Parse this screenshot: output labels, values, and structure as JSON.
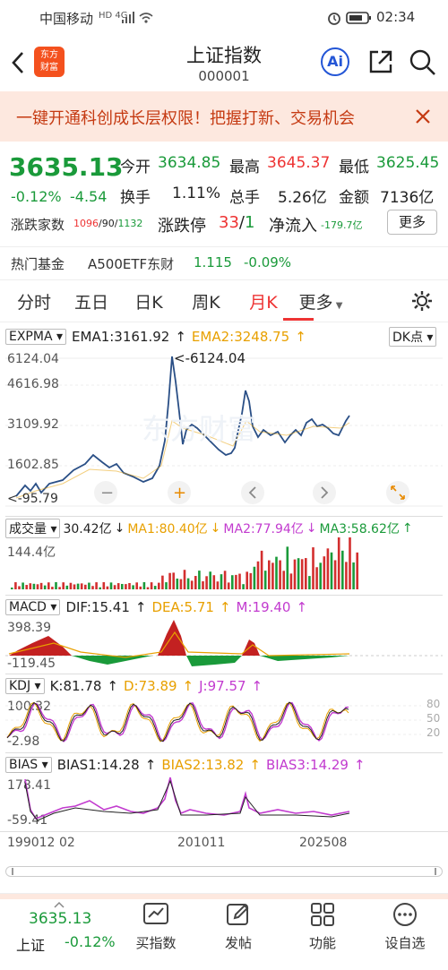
{
  "status_bar": {
    "carrier": "中国移动",
    "net": "HD 4G",
    "time": "02:34"
  },
  "header": {
    "title": "上证指数",
    "code": "000001",
    "logo_line1": "东方",
    "logo_line2": "财富",
    "ai_label": "Ai"
  },
  "banner": {
    "text": "一键开通科创成长层权限！把握打新、交易机会"
  },
  "quote": {
    "price": "3635.13",
    "change_pct": "-0.12%",
    "change": "-4.54",
    "open_label": "今开",
    "open": "3634.85",
    "high_label": "最高",
    "high": "3645.37",
    "low_label": "最低",
    "low": "3625.45",
    "turnover_label": "换手",
    "turnover": "1.11%",
    "volume_label": "总手",
    "volume": "5.26亿",
    "amount_label": "金额",
    "amount": "7136亿",
    "breadth_label": "涨跌家数",
    "up": "1096",
    "flat": "90",
    "down": "1132",
    "limit_label": "涨跌停",
    "limit_up": "33",
    "limit_down": "1",
    "inflow_label": "净流入",
    "inflow": "-179.7亿",
    "more_label": "更多"
  },
  "fund": {
    "label": "热门基金",
    "name": "A500ETF东财",
    "price": "1.115",
    "pct": "-0.09%"
  },
  "tabs": [
    "分时",
    "五日",
    "日K",
    "周K",
    "月K",
    "更多"
  ],
  "main_chart": {
    "indicator": "EXPMA",
    "ema1": "EMA1:3161.92",
    "ema2": "EMA2:3248.75",
    "dk": "DK点",
    "y_labels": [
      "6124.04",
      "4616.98",
      "3109.92",
      "1602.85",
      "95.79"
    ],
    "max_marker": "<-6124.04",
    "min_marker": "<-95.79"
  },
  "volume_chart": {
    "label": "成交量",
    "vol": "30.42亿",
    "ma1": "MA1:80.40亿",
    "ma2": "MA2:77.94亿",
    "ma3": "MA3:58.62亿",
    "top": "144.4亿"
  },
  "macd_chart": {
    "label": "MACD",
    "dif": "DIF:15.41",
    "dea": "DEA:5.71",
    "m": "M:19.40",
    "top": "398.39",
    "bottom": "-119.45"
  },
  "kdj_chart": {
    "label": "KDJ",
    "k": "K:81.78",
    "d": "D:73.89",
    "j": "J:97.57",
    "top": "100.32",
    "bottom": "-2.98",
    "levels": [
      "80",
      "50",
      "20"
    ]
  },
  "bias_chart": {
    "label": "BIAS",
    "b1": "BIAS1:14.28",
    "b2": "BIAS2:13.82",
    "b3": "BIAS3:14.29",
    "top": "178.41",
    "bottom": "-59.41"
  },
  "x_axis": [
    "199012",
    "201011",
    "202508"
  ],
  "x_axis_partial": "02",
  "bottom_nav": {
    "price": "3635.13",
    "index": "上证",
    "pct": "-0.12%",
    "items": [
      "买指数",
      "发帖",
      "功能",
      "设自选"
    ]
  },
  "colors": {
    "up": "#e33333",
    "down": "#1a9a3a",
    "accent": "#e8a000",
    "brand": "#f4511e"
  }
}
